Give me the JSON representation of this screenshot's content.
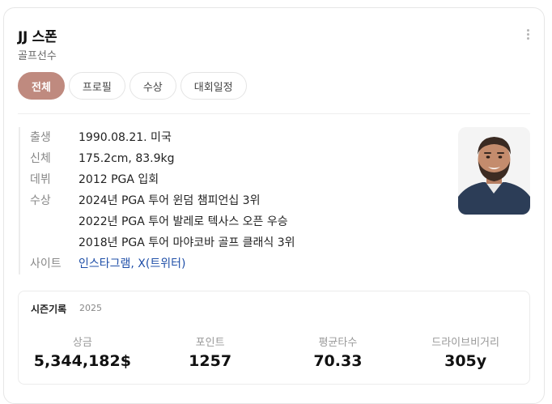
{
  "player": {
    "name": "JJ 스폰",
    "role": "골프선수"
  },
  "tabs": [
    {
      "label": "전체",
      "active": true
    },
    {
      "label": "프로필",
      "active": false
    },
    {
      "label": "수상",
      "active": false
    },
    {
      "label": "대회일정",
      "active": false
    }
  ],
  "profile": {
    "birth_label": "출생",
    "birth_value": "1990.08.21. 미국",
    "body_label": "신체",
    "body_value": "175.2cm, 83.9kg",
    "debut_label": "데뷔",
    "debut_value": "2012 PGA 입회",
    "awards_label": "수상",
    "awards": [
      "2024년 PGA 투어 윈덤 챔피언십 3위",
      "2022년 PGA 투어 발레로 텍사스 오픈 우승",
      "2018년 PGA 투어 마야코바 골프 클래식 3위"
    ],
    "site_label": "사이트",
    "site_value": "인스타그램, X(트위터)"
  },
  "season": {
    "title": "시즌기록",
    "year": "2025",
    "stats": [
      {
        "label": "상금",
        "value": "5,344,182$"
      },
      {
        "label": "포인트",
        "value": "1257"
      },
      {
        "label": "평균타수",
        "value": "70.33"
      },
      {
        "label": "드라이브비거리",
        "value": "305y"
      }
    ]
  },
  "icons": {
    "more": "more-vertical-icon"
  },
  "colors": {
    "active_tab": "#bf8a7f",
    "link": "#1f4fa8"
  }
}
